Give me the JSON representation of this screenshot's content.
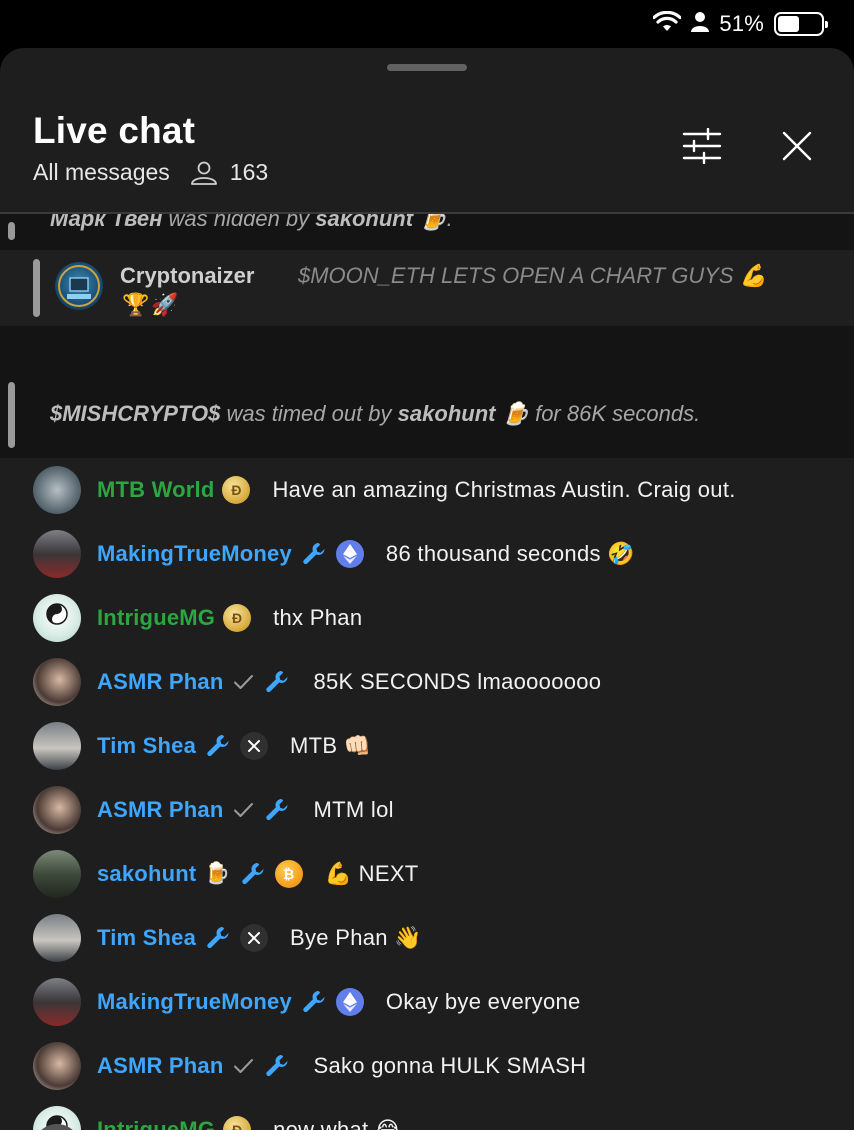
{
  "status_bar": {
    "battery_percent": "51%",
    "battery_level": 0.51
  },
  "header": {
    "title": "Live chat",
    "filter_label": "All messages",
    "viewer_count": "163"
  },
  "system_messages": [
    {
      "user": "Марк Твен",
      "text": " was hidden by ",
      "moderator": "sakohunt",
      "suffix": " 🍺."
    },
    {
      "user": "$MISHCRYPTO$",
      "text": " was timed out by ",
      "moderator": "sakohunt",
      "suffix": " 🍺 for 86K seconds."
    }
  ],
  "pinned_message": {
    "author": "Cryptonaizer",
    "text": "$MOON_ETH LETS OPEN A CHART GUYS 💪",
    "extra": "🏆🚀"
  },
  "messages": [
    {
      "author": "MTB World",
      "color": "green",
      "badges": [
        "coin"
      ],
      "text": "Have an amazing Christmas Austin. Craig out."
    },
    {
      "author": "MakingTrueMoney",
      "color": "blue",
      "badges": [
        "wrench",
        "eth"
      ],
      "text": "86 thousand seconds 🤣"
    },
    {
      "author": "IntrigueMG",
      "color": "green",
      "badges": [
        "coin"
      ],
      "text": "thx Phan"
    },
    {
      "author": "ASMR Phan",
      "color": "blue",
      "badges": [
        "check",
        "wrench"
      ],
      "text": "85K SECONDS lmaooooooo"
    },
    {
      "author": "Tim Shea",
      "color": "blue",
      "badges": [
        "wrench",
        "x"
      ],
      "text": "MTB 👊🏻"
    },
    {
      "author": "ASMR Phan",
      "color": "blue",
      "badges": [
        "check",
        "wrench"
      ],
      "text": "MTM lol"
    },
    {
      "author": "sakohunt",
      "color": "blue",
      "badges": [
        "beer",
        "wrench",
        "btc"
      ],
      "text": "💪 NEXT"
    },
    {
      "author": "Tim Shea",
      "color": "blue",
      "badges": [
        "wrench",
        "x"
      ],
      "text": "Bye Phan 👋"
    },
    {
      "author": "MakingTrueMoney",
      "color": "blue",
      "badges": [
        "wrench",
        "eth"
      ],
      "text": "Okay bye everyone"
    },
    {
      "author": "ASMR Phan",
      "color": "blue",
      "badges": [
        "check",
        "wrench"
      ],
      "text": "Sako gonna HULK SMASH"
    },
    {
      "author": "IntrigueMG",
      "color": "green",
      "badges": [
        "coin"
      ],
      "text": "now what 😂"
    }
  ],
  "colors": {
    "background": "#1e1e1e",
    "author_blue": "#3ea6ff",
    "author_green": "#2ba640",
    "system_row": "#141414"
  }
}
